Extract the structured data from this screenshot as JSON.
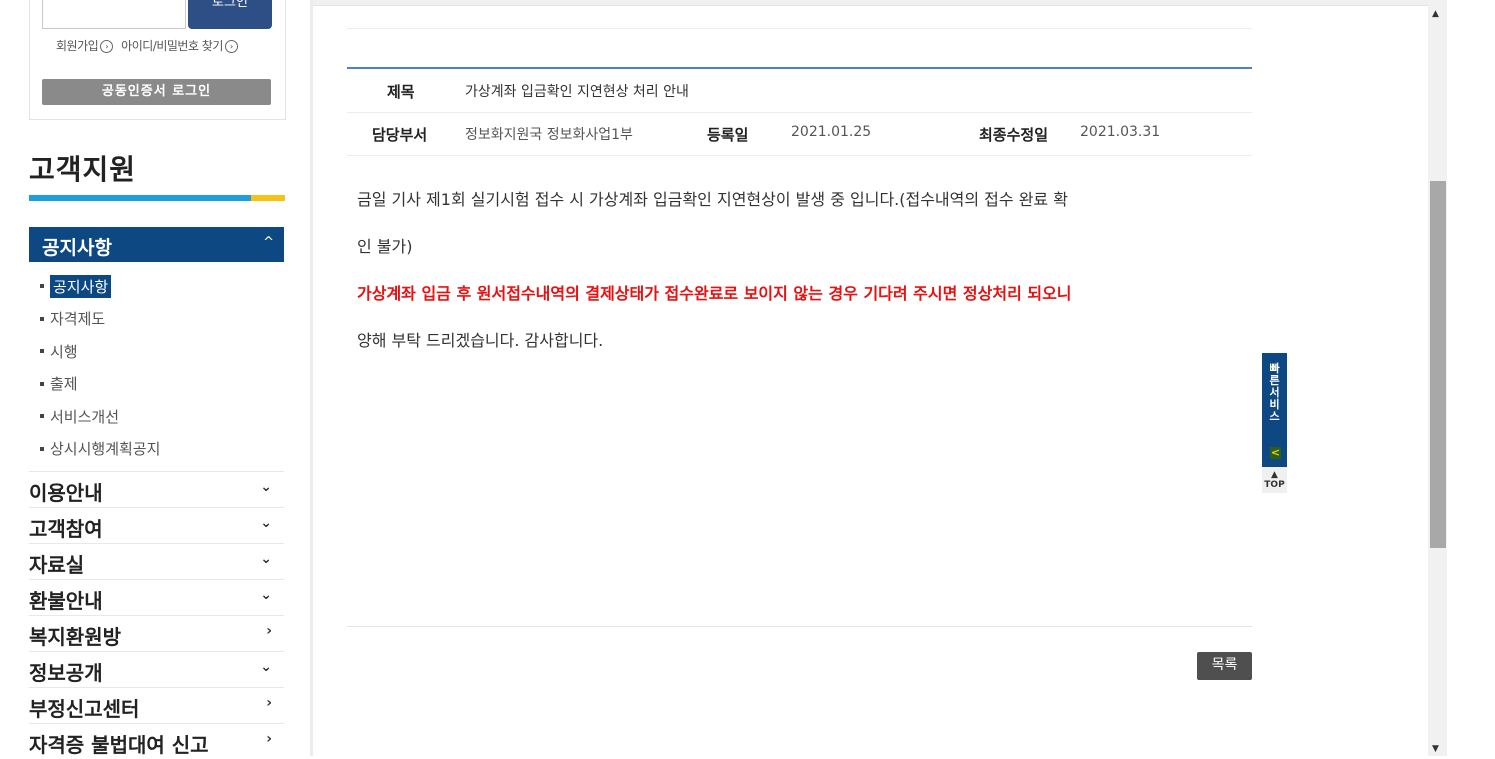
{
  "login": {
    "button_label": "로그인",
    "links": [
      "회원가입",
      "아이디/비밀번호 찾기"
    ],
    "cert_button": "공동인증서 로그인"
  },
  "sidebar": {
    "title": "고객지원",
    "active_menu": "공지사항",
    "submenu": [
      "공지사항",
      "자격제도",
      "시행",
      "출제",
      "서비스개선",
      "상시시행계획공지"
    ],
    "menu": [
      {
        "label": "이용안내",
        "arrow": "⌄"
      },
      {
        "label": "고객참여",
        "arrow": "⌄"
      },
      {
        "label": "자료실",
        "arrow": "⌄"
      },
      {
        "label": "환불안내",
        "arrow": "⌄"
      },
      {
        "label": "복지환원방",
        "arrow": "›"
      },
      {
        "label": "정보공개",
        "arrow": "⌄"
      },
      {
        "label": "부정신고센터",
        "arrow": "›"
      },
      {
        "label": "자격증 불법대여 신고",
        "arrow": "›"
      }
    ]
  },
  "article": {
    "title_label": "제목",
    "title": "가상계좌 입금확인 지연현상 처리 안내",
    "dept_label": "담당부서",
    "dept": "정보화지원국 정보화사업1부",
    "reg_label": "등록일",
    "reg_date": "2021.01.25",
    "mod_label": "최종수정일",
    "mod_date": "2021.03.31",
    "body_line1": "금일 기사 제1회 실기시험 접수 시 가상계좌 입금확인 지연현상이 발생 중 입니다.(접수내역의 접수 완료 확",
    "body_line2": "인 불가)",
    "body_red": "가상계좌 입금 후 원서접수내역의 결제상태가 접수완료로 보이지 않는 경우 기다려 주시면 정상처리 되오니",
    "body_line4": "양해 부탁 드리겠습니다. 감사합니다.",
    "list_button": "목록"
  },
  "quick": {
    "label": "빠른서비스",
    "collapse_glyph": "<",
    "top_label": "TOP"
  }
}
